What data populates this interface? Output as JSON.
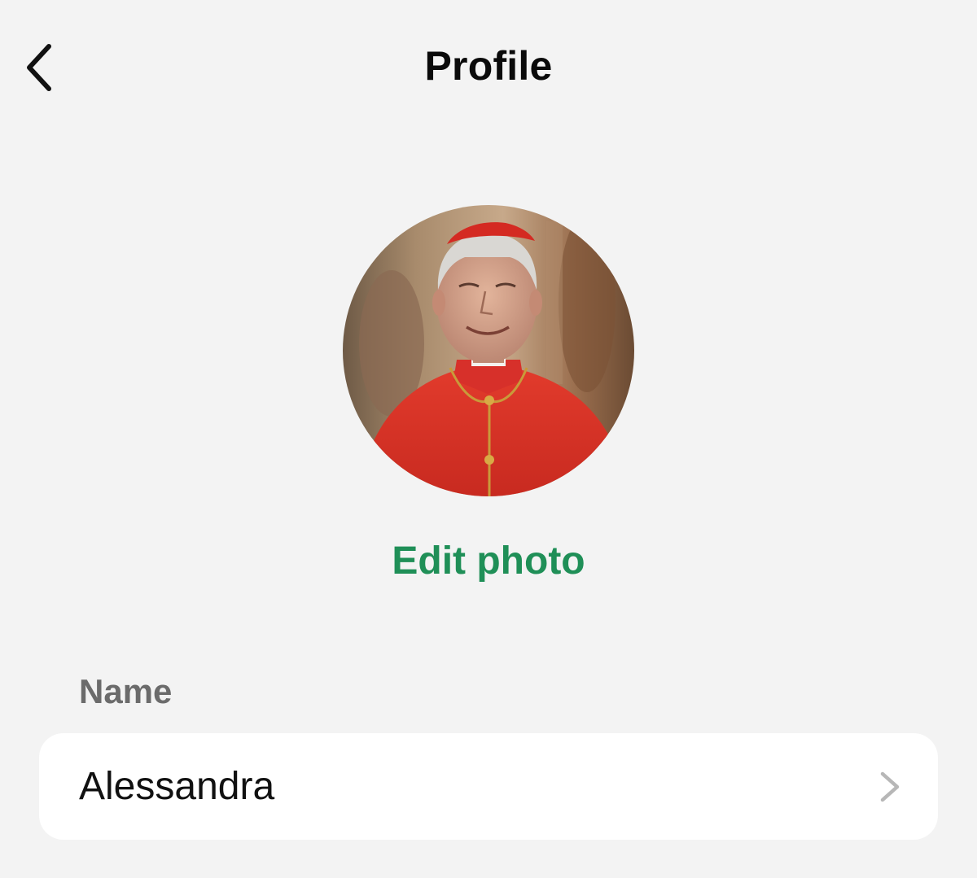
{
  "header": {
    "title": "Profile",
    "back_icon": "chevron-left-icon"
  },
  "avatar": {
    "description_icon": "profile-photo"
  },
  "edit_photo_label": "Edit photo",
  "name_section": {
    "label": "Name",
    "value": "Alessandra",
    "chevron_icon": "chevron-right-icon"
  },
  "colors": {
    "background": "#f3f3f3",
    "accent_green": "#1f8f57",
    "label_gray": "#6b6b6b",
    "card": "#ffffff"
  }
}
